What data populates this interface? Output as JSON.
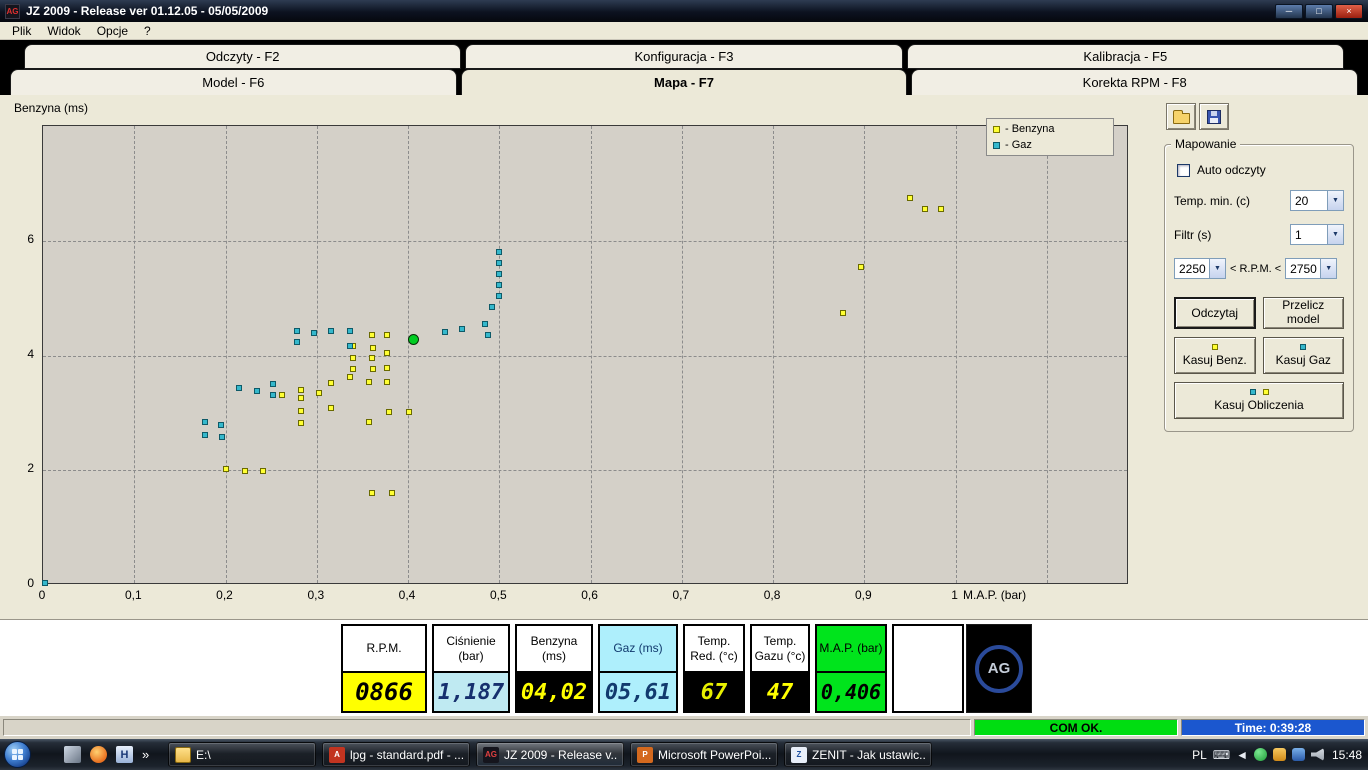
{
  "window": {
    "title": "JZ 2009  - Release  ver 01.12.05 - 05/05/2009",
    "icon_text": "AG"
  },
  "menu": {
    "items": [
      "Plik",
      "Widok",
      "Opcje",
      "?"
    ]
  },
  "tabs": {
    "row1": [
      "Odczyty - F2",
      "Konfiguracja - F3",
      "Kalibracja - F5"
    ],
    "row2": [
      "Model - F6",
      "Mapa - F7",
      "Korekta RPM - F8"
    ],
    "active": "Mapa - F7"
  },
  "chart_data": {
    "type": "scatter",
    "title": "",
    "ylabel": "Benzyna (ms)",
    "xlabel": "M.A.P. (bar)",
    "xlim": [
      0,
      1.19
    ],
    "ylim": [
      0,
      8
    ],
    "grid": "dashed",
    "legend_position": "top-right",
    "x_ticks": [
      {
        "v": 0,
        "label": "0"
      },
      {
        "v": 0.1,
        "label": "0,1"
      },
      {
        "v": 0.2,
        "label": "0,2"
      },
      {
        "v": 0.3,
        "label": "0,3"
      },
      {
        "v": 0.4,
        "label": "0,4"
      },
      {
        "v": 0.5,
        "label": "0,5"
      },
      {
        "v": 0.6,
        "label": "0,6"
      },
      {
        "v": 0.7,
        "label": "0,7"
      },
      {
        "v": 0.8,
        "label": "0,8"
      },
      {
        "v": 0.9,
        "label": "0,9"
      },
      {
        "v": 1,
        "label": "1"
      }
    ],
    "y_ticks": [
      {
        "v": 0,
        "label": "0"
      },
      {
        "v": 2,
        "label": "2"
      },
      {
        "v": 4,
        "label": "4"
      },
      {
        "v": 6,
        "label": "6"
      }
    ],
    "grid_x": [
      0.1,
      0.2,
      0.3,
      0.4,
      0.5,
      0.6,
      0.7,
      0.8,
      0.9,
      1.0,
      1.1
    ],
    "grid_y": [
      2,
      4,
      6
    ],
    "legend": [
      {
        "label": "- Benzyna",
        "color": "#ffff33",
        "border": "#7a7a00"
      },
      {
        "label": "- Gaz",
        "color": "#35b8cc",
        "border": "#0e5a68"
      }
    ],
    "series": [
      {
        "name": "benzyna",
        "color": "#ffff33",
        "border": "#6a6a00",
        "points": [
          [
            0.95,
            6.75
          ],
          [
            0.966,
            6.55
          ],
          [
            0.984,
            6.55
          ],
          [
            0.896,
            5.55
          ],
          [
            0.877,
            4.75
          ],
          [
            0.36,
            4.35
          ],
          [
            0.377,
            4.35
          ],
          [
            0.34,
            4.17
          ],
          [
            0.361,
            4.13
          ],
          [
            0.377,
            4.05
          ],
          [
            0.34,
            3.96
          ],
          [
            0.36,
            3.96
          ],
          [
            0.377,
            3.79
          ],
          [
            0.34,
            3.77
          ],
          [
            0.361,
            3.77
          ],
          [
            0.336,
            3.63
          ],
          [
            0.357,
            3.54
          ],
          [
            0.377,
            3.54
          ],
          [
            0.316,
            3.52
          ],
          [
            0.302,
            3.35
          ],
          [
            0.283,
            3.4
          ],
          [
            0.283,
            3.26
          ],
          [
            0.262,
            3.31
          ],
          [
            0.283,
            3.04
          ],
          [
            0.316,
            3.09
          ],
          [
            0.357,
            2.84
          ],
          [
            0.379,
            3.02
          ],
          [
            0.401,
            3.02
          ],
          [
            0.283,
            2.83
          ],
          [
            0.2,
            2.02
          ],
          [
            0.221,
            1.99
          ],
          [
            0.241,
            1.99
          ],
          [
            0.36,
            1.6
          ],
          [
            0.382,
            1.6
          ]
        ]
      },
      {
        "name": "gaz",
        "color": "#35b8cc",
        "border": "#0e5a68",
        "points": [
          [
            0.5,
            5.8
          ],
          [
            0.5,
            5.61
          ],
          [
            0.5,
            5.42
          ],
          [
            0.5,
            5.23
          ],
          [
            0.5,
            5.04
          ],
          [
            0.492,
            4.85
          ],
          [
            0.484,
            4.55
          ],
          [
            0.488,
            4.36
          ],
          [
            0.459,
            4.47
          ],
          [
            0.44,
            4.41
          ],
          [
            0.278,
            4.43
          ],
          [
            0.297,
            4.4
          ],
          [
            0.316,
            4.43
          ],
          [
            0.336,
            4.43
          ],
          [
            0.278,
            4.24
          ],
          [
            0.336,
            4.17
          ],
          [
            0.215,
            3.44
          ],
          [
            0.234,
            3.38
          ],
          [
            0.252,
            3.51
          ],
          [
            0.252,
            3.31
          ],
          [
            0.178,
            2.84
          ],
          [
            0.195,
            2.79
          ],
          [
            0.178,
            2.62
          ],
          [
            0.196,
            2.58
          ],
          [
            0.002,
            0.04
          ]
        ]
      }
    ],
    "current_marker": {
      "x": 0.406,
      "y": 4.28,
      "color": "#00cc22"
    }
  },
  "side_panel": {
    "group_title": "Mapowanie",
    "auto_label": "Auto odczyty",
    "temp_min_label": "Temp. min. (c)",
    "temp_min_value": "20",
    "filtr_label": "Filtr (s)",
    "filtr_value": "1",
    "rpm_low": "2250",
    "rpm_label": "< R.P.M. <",
    "rpm_high": "2750",
    "btn_odczytaj": "Odczytaj",
    "btn_przelicz": "Przelicz model",
    "btn_kasuj_benz": "Kasuj Benz.",
    "btn_kasuj_gaz": "Kasuj Gaz",
    "btn_kasuj_obliczenia": "Kasuj Obliczenia"
  },
  "readouts": [
    {
      "name": "rpm",
      "label": "R.P.M.",
      "value": "0866",
      "label_bg": "#ffffff",
      "label_fg": "#000000",
      "value_bg": "#ffff00",
      "value_fg": "#000000"
    },
    {
      "name": "cisnienie",
      "label": "Ciśnienie\n(bar)",
      "value": "1,187",
      "label_bg": "#ffffff",
      "label_fg": "#000000",
      "value_bg": "#bfeaf2",
      "value_fg": "#16306e"
    },
    {
      "name": "benzyna",
      "label": "Benzyna\n(ms)",
      "value": "04,02",
      "label_bg": "#ffffff",
      "label_fg": "#000000",
      "value_bg": "#000000",
      "value_fg": "#ffff00"
    },
    {
      "name": "gaz",
      "label": "Gaz (ms)",
      "value": "05,61",
      "label_bg": "#aeeffc",
      "label_fg": "#123a6e",
      "value_bg": "#aeeffc",
      "value_fg": "#123a6e"
    },
    {
      "name": "temp-red",
      "label": "Temp.\nRed. (°c)",
      "value": "67",
      "label_bg": "#ffffff",
      "label_fg": "#000000",
      "value_bg": "#000000",
      "value_fg": "#e8f000"
    },
    {
      "name": "temp-gazu",
      "label": "Temp.\nGazu (°c)",
      "value": "47",
      "label_bg": "#ffffff",
      "label_fg": "#000000",
      "value_bg": "#000000",
      "value_fg": "#ffff00"
    },
    {
      "name": "map",
      "label": "M.A.P. (bar)",
      "value": "0,406",
      "label_bg": "#00e41c",
      "label_fg": "#000000",
      "value_bg": "#00e41c",
      "value_fg": "#000000"
    },
    {
      "name": "empty",
      "label": "",
      "value": "",
      "label_bg": "#ffffff",
      "label_fg": "#000000",
      "value_bg": "#ffffff",
      "value_fg": "#000000"
    }
  ],
  "branding": {
    "logo_text": "AG"
  },
  "status_bar": {
    "com": "COM OK.",
    "time": "Time: 0:39:28"
  },
  "taskbar": {
    "buttons": [
      {
        "label": "E:\\",
        "icon": "folder"
      },
      {
        "label": "lpg - standard.pdf - ...",
        "icon": "pdf",
        "icon_bg": "#c23420",
        "icon_fg": "#ffffff",
        "icon_text": "A"
      },
      {
        "label": "JZ 2009  - Release  v...",
        "icon": "ag",
        "icon_bg": "#15151d",
        "icon_fg": "#e04040",
        "icon_text": "AG",
        "active": true
      },
      {
        "label": "Microsoft PowerPoi...",
        "icon": "powerpoint",
        "icon_bg": "#d4691e",
        "icon_fg": "#ffffff",
        "icon_text": "P"
      },
      {
        "label": "ZENIT - Jak ustawic....",
        "icon": "zenit",
        "icon_bg": "#e8eef8",
        "icon_fg": "#1d4f9e",
        "icon_text": "Z"
      }
    ],
    "tray": {
      "lang": "PL",
      "time": "15:48"
    }
  }
}
